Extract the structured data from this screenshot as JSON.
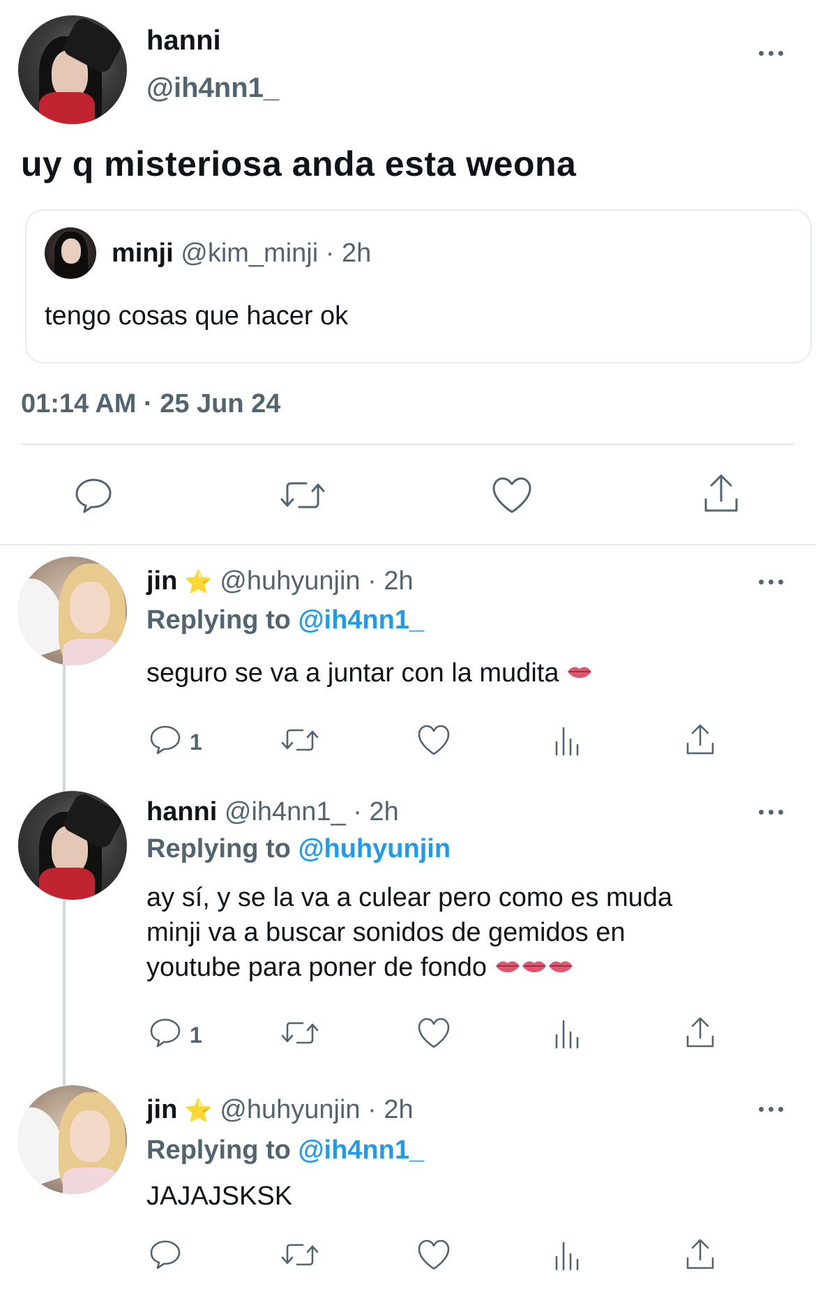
{
  "main_tweet": {
    "name": "hanni",
    "handle": "@ih4nn1_",
    "text": "uy q misteriosa anda esta weona",
    "quote": {
      "name": "minji",
      "handle": "@kim_minji",
      "time": "· 2h",
      "text": "tengo cosas que hacer ok"
    },
    "timestamp": "01:14 AM · 25 Jun 24"
  },
  "replies": [
    {
      "name": "jin",
      "star": "⭐",
      "meta": "@huhyunjin · 2h",
      "replying_prefix": "Replying to",
      "replying_to": "@ih4nn1_",
      "text": "seguro se va a juntar con la mudita",
      "reply_count": "1"
    },
    {
      "name": "hanni",
      "meta": "@ih4nn1_ · 2h",
      "replying_prefix": "Replying to",
      "replying_to": "@huhyunjin",
      "lines": [
        "ay sí, y se la va a culear pero como es muda",
        "minji va a buscar sonidos de gemidos en",
        "youtube para poner de fondo"
      ],
      "reply_count": "1"
    },
    {
      "name": "jin",
      "star": "⭐",
      "meta": "@huhyunjin · 2h",
      "replying_prefix": "Replying to",
      "replying_to": "@ih4nn1_",
      "text": "JAJAJSKSK",
      "reply_count": ""
    }
  ],
  "icons": [
    "reply-icon",
    "retweet-icon",
    "like-icon",
    "views-icon",
    "share-icon",
    "more-icon",
    "lips-emoji"
  ],
  "colors": {
    "link": "#1d9bf0",
    "muted": "#536471",
    "divider": "#eff3f4",
    "text": "#0f1419"
  }
}
